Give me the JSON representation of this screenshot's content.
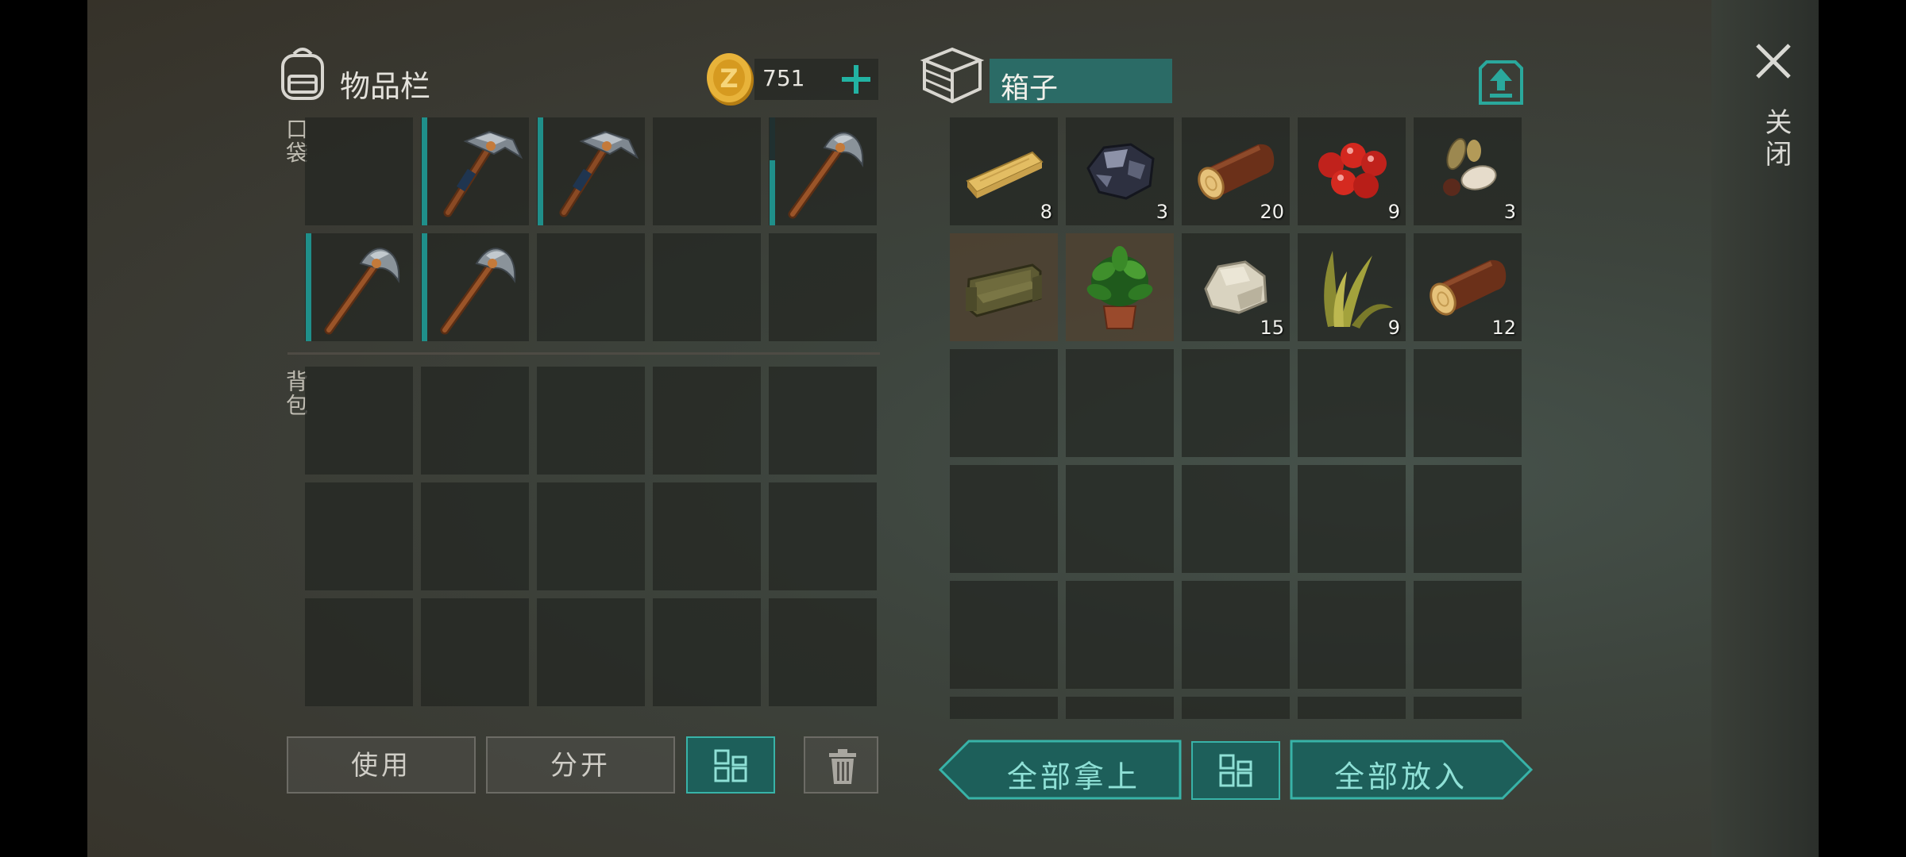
{
  "inventory": {
    "title": "物品栏",
    "pocket_label": "口袋",
    "backpack_label": "背包",
    "coins": "751",
    "pocket_items": [
      {
        "slot": 1,
        "item": "hammer-icon",
        "durability": 1.0
      },
      {
        "slot": 2,
        "item": "hammer-icon",
        "durability": 1.0
      },
      {
        "slot": 4,
        "item": "pickaxe-icon",
        "durability": 0.6
      },
      {
        "slot": 5,
        "item": "pickaxe-icon",
        "durability": 1.0
      },
      {
        "slot": 6,
        "item": "pickaxe-icon",
        "durability": 1.0
      }
    ]
  },
  "box": {
    "name": "箱子",
    "items": [
      {
        "name": "plank-icon",
        "count": "8"
      },
      {
        "name": "iron-ore-icon",
        "count": "3"
      },
      {
        "name": "log-icon",
        "count": "20"
      },
      {
        "name": "berries-icon",
        "count": "9"
      },
      {
        "name": "seeds-icon",
        "count": "3"
      },
      {
        "name": "sofa-icon",
        "count": ""
      },
      {
        "name": "potted-plant-icon",
        "count": ""
      },
      {
        "name": "stone-icon",
        "count": "15"
      },
      {
        "name": "plant-fiber-icon",
        "count": "9"
      },
      {
        "name": "log-icon",
        "count": "12"
      }
    ]
  },
  "buttons": {
    "use": "使用",
    "split": "分开",
    "take_all": "全部拿上",
    "put_all": "全部放入",
    "close": "关闭"
  },
  "colors": {
    "accent": "#1f8f8a",
    "accent_light": "#38b3a8",
    "coin": "#e3ad2a"
  }
}
